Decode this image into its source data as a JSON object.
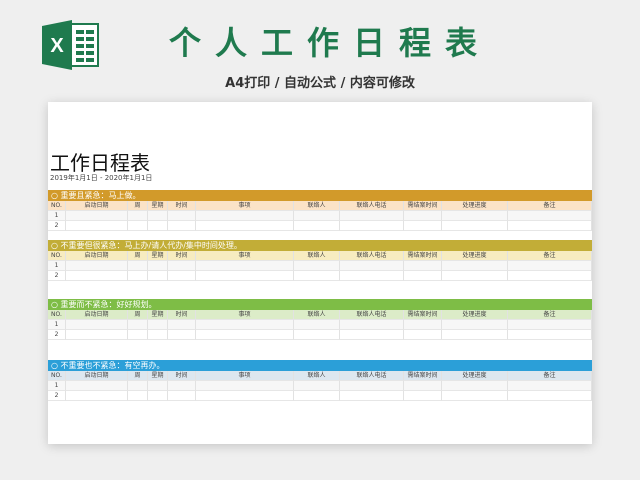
{
  "banner": {
    "title": "个人工作日程表",
    "subtitle": "A4打印 / 自动公式 / 内容可修改"
  },
  "logo": {
    "icon": "excel-icon",
    "letter": "X",
    "color": "#1f7a4e"
  },
  "document": {
    "title": "工作日程表",
    "date_range": "2019年1月1日 - 2020年1月1日"
  },
  "columns": [
    "NO.",
    "启动日期",
    "周",
    "星期",
    "时间",
    "事项",
    "联络人",
    "联络人电话",
    "需结案时间",
    "处理进度",
    "备注"
  ],
  "sections": [
    {
      "title": "○ 重要且紧急：马上做。",
      "color": "#d29a2a",
      "header_bg": "#fbe3c7",
      "rows": [
        "1",
        "2"
      ]
    },
    {
      "title": "○ 不重要但很紧急：马上办/请人代办/集中时间处理。",
      "color": "#c2ad37",
      "header_bg": "#f7ecc0",
      "rows": [
        "1",
        "2"
      ]
    },
    {
      "title": "○ 重要而不紧急：好好规划。",
      "color": "#7ebd46",
      "header_bg": "#dcecc8",
      "rows": [
        "1",
        "2"
      ]
    },
    {
      "title": "○ 不重要也不紧急：有空再办。",
      "color": "#2b9fd8",
      "header_bg": "#dde7ef",
      "rows": [
        "1",
        "2"
      ]
    }
  ]
}
